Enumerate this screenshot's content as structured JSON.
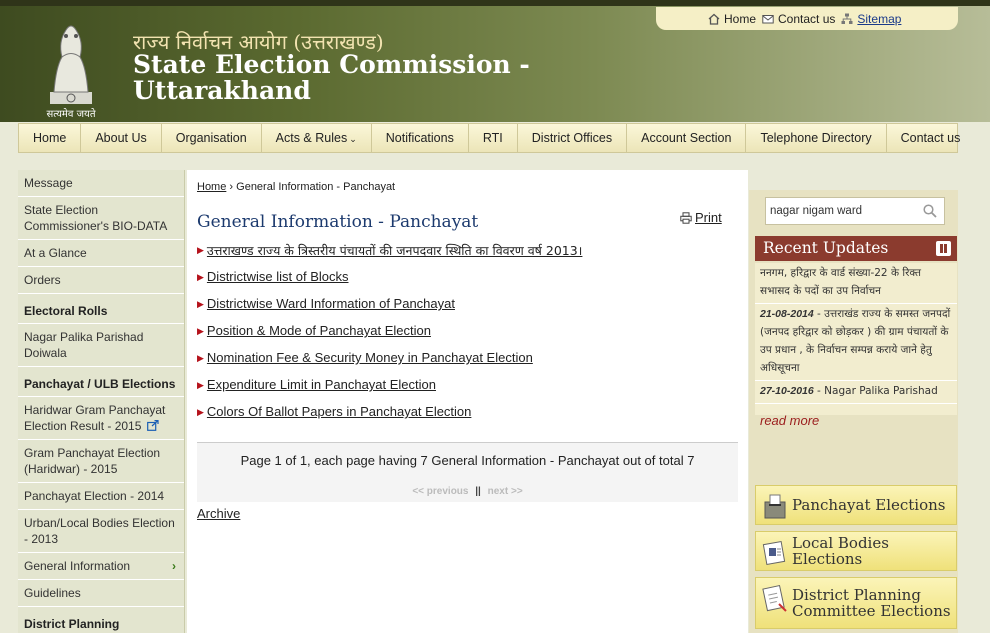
{
  "header": {
    "emblem_caption": "सत्यमेव जयते",
    "title_hindi": "राज्य निर्वाचन आयोग (उत्तराखण्ड)",
    "title_en": "State Election Commission - Uttarakhand",
    "toplinks": {
      "home": "Home",
      "contact": "Contact us",
      "sitemap": "Sitemap"
    }
  },
  "nav": [
    "Home",
    "About Us",
    "Organisation",
    "Acts & Rules",
    "Notifications",
    "RTI",
    "District Offices",
    "Account Section",
    "Telephone Directory",
    "Contact us"
  ],
  "sidebar": {
    "items_top": [
      "Message",
      "State Election Commissioner's BIO-DATA",
      "At a Glance",
      "Orders"
    ],
    "electoral_rolls_heading": "Electoral Rolls",
    "electoral_items": [
      "Nagar Palika Parishad Doiwala"
    ],
    "panchayat_heading": "Panchayat / ULB Elections",
    "panchayat_items": [
      "Haridwar Gram Panchayat Election Result - 2015",
      "Gram Panchayat Election (Haridwar) - 2015",
      "Panchayat Election - 2014",
      "Urban/Local Bodies Election - 2013",
      "General Information",
      "Guidelines",
      "District Planning"
    ]
  },
  "main": {
    "breadcrumb_home": "Home",
    "breadcrumb_current": "General Information - Panchayat",
    "title": "General Information - Panchayat",
    "print": "Print",
    "links": [
      "उत्तराखण्ड राज्य के त्रिस्तरीय पंचायतों की जनपदवार स्थिति का विवरण वर्ष 2013।",
      "Districtwise list of Blocks",
      "Districtwise Ward Information of Panchayat",
      "Position & Mode of Panchayat Election",
      "Nomination Fee & Security Money in Panchayat Election",
      "Expenditure Limit in Panchayat Election",
      "Colors Of Ballot Papers in Panchayat Election"
    ],
    "pager_text": "Page 1 of 1, each page having 7 General Information - Panchayat out of total 7",
    "pager_prev": "<< previous",
    "pager_sep": "||",
    "pager_next": "next >>",
    "archive": "Archive"
  },
  "right": {
    "search_value": "nagar nigam ward",
    "recent_updates_title": "Recent Updates",
    "updates": [
      {
        "date": "",
        "text": "ननगम, हरिद्वार के वार्ड संख्या-22 के रिक्त सभासद के पदों का उप निर्वाचन"
      },
      {
        "date": "21-08-2014",
        "text": " - उत्तराखंड राज्य के समस्त जनपदों (जनपद हरिद्वार को छोड़कर ) की ग्राम पंचायतों के उप प्रधान , के निर्वाचन सम्पन्न कराये जाने हेतु अधिसूचना"
      },
      {
        "date": "27-10-2016",
        "text": " - Nagar Palika Parishad"
      }
    ],
    "read_more": "read more",
    "boxes": [
      "Panchayat Elections",
      "Local Bodies Elections",
      "District Planning Committee Elections"
    ]
  }
}
